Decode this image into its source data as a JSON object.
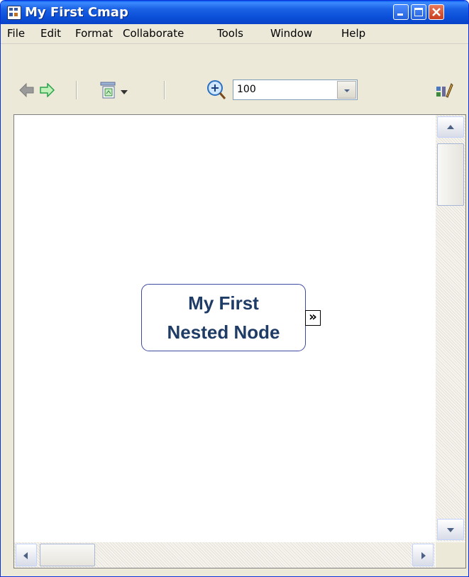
{
  "window": {
    "title": "My First Cmap",
    "icons": {
      "app": "cmap-app-icon",
      "minimize": "minimize-icon",
      "maximize": "maximize-icon",
      "close": "close-icon"
    }
  },
  "menu": {
    "items": [
      "File",
      "Edit",
      "Format",
      "Collaborate",
      "Tools",
      "Window",
      "Help"
    ]
  },
  "toolbar": {
    "zoom_value": "100",
    "icons": [
      "back-arrow-icon",
      "forward-arrow-icon",
      "nested-node-view-icon",
      "dropdown-arrow-icon",
      "zoom-in-icon",
      "chevron-down-icon",
      "style-palette-icon"
    ],
    "colors": {
      "back_disabled": "#8a8a8a",
      "forward": "#2aa14a"
    }
  },
  "canvas": {
    "node": {
      "line1": "My First",
      "line2": "Nested Node"
    },
    "nested_icon_glyph": "»",
    "node_text_color": "#1f3c66",
    "node_border_color": "#3d4a9f"
  },
  "scrollbars": {
    "vertical_position": 0,
    "horizontal_position": 0
  }
}
